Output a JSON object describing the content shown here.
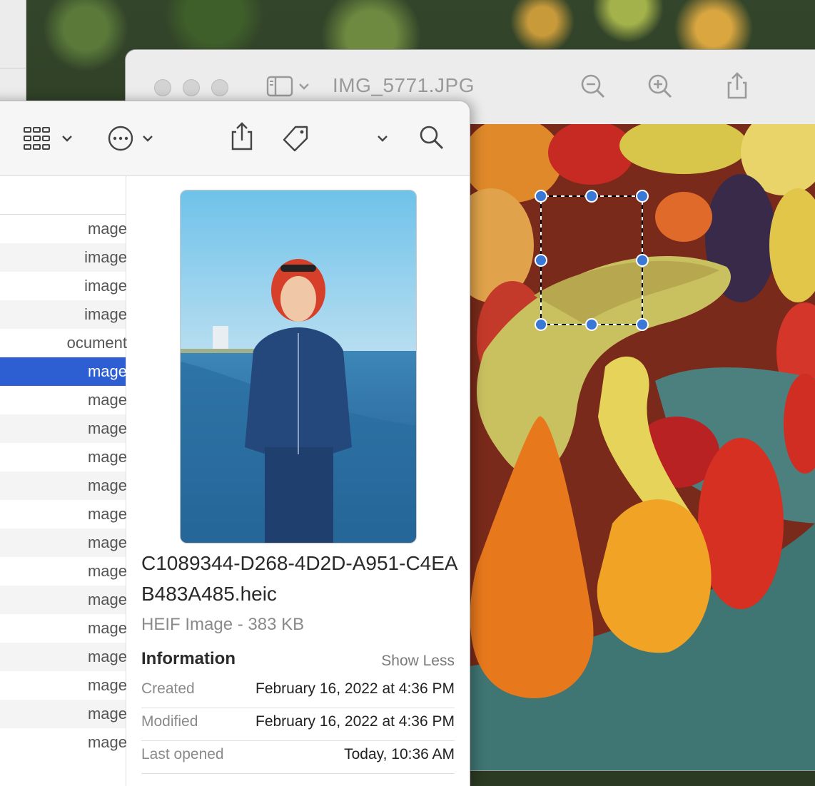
{
  "preview": {
    "title": "IMG_5771.JPG",
    "toolbar_icons": [
      "sidebar-toggle-icon",
      "chevron-down-icon",
      "zoom-out-icon",
      "zoom-in-icon",
      "share-icon"
    ]
  },
  "finder": {
    "toolbar_icons": [
      "icon-view-grid-icon",
      "chevron-down-icon",
      "more-ellipsis-icon",
      "share-icon",
      "tag-icon",
      "search-icon"
    ],
    "rows": [
      {
        "kind": "mage",
        "style": "normal"
      },
      {
        "kind": "image",
        "style": "alt"
      },
      {
        "kind": "image",
        "style": "normal"
      },
      {
        "kind": "image",
        "style": "alt"
      },
      {
        "kind": "ocument",
        "style": "normal"
      },
      {
        "kind": "mage",
        "style": "selected"
      },
      {
        "kind": "mage",
        "style": "normal"
      },
      {
        "kind": "mage",
        "style": "alt"
      },
      {
        "kind": "mage",
        "style": "normal"
      },
      {
        "kind": "mage",
        "style": "alt"
      },
      {
        "kind": "mage",
        "style": "normal"
      },
      {
        "kind": "mage",
        "style": "alt"
      },
      {
        "kind": "mage",
        "style": "normal"
      },
      {
        "kind": "mage",
        "style": "alt"
      },
      {
        "kind": "mage",
        "style": "normal"
      },
      {
        "kind": "mage",
        "style": "alt"
      },
      {
        "kind": "mage",
        "style": "normal"
      },
      {
        "kind": "mage",
        "style": "alt"
      },
      {
        "kind": "mage",
        "style": "normal"
      }
    ],
    "inspector": {
      "file_name": "C1089344-D268-4D2D-A951-C4EAB483A485.heic",
      "file_kind": "HEIF Image - 383 KB",
      "info_heading": "Information",
      "show_less": "Show Less",
      "info": [
        {
          "label": "Created",
          "value": "February 16, 2022 at 4:36 PM"
        },
        {
          "label": "Modified",
          "value": "February 16, 2022 at 4:36 PM"
        },
        {
          "label": "Last opened",
          "value": "Today, 10:36 AM"
        }
      ]
    }
  },
  "colors": {
    "selection": "#2d5fd3",
    "handle": "#3a78d8"
  }
}
